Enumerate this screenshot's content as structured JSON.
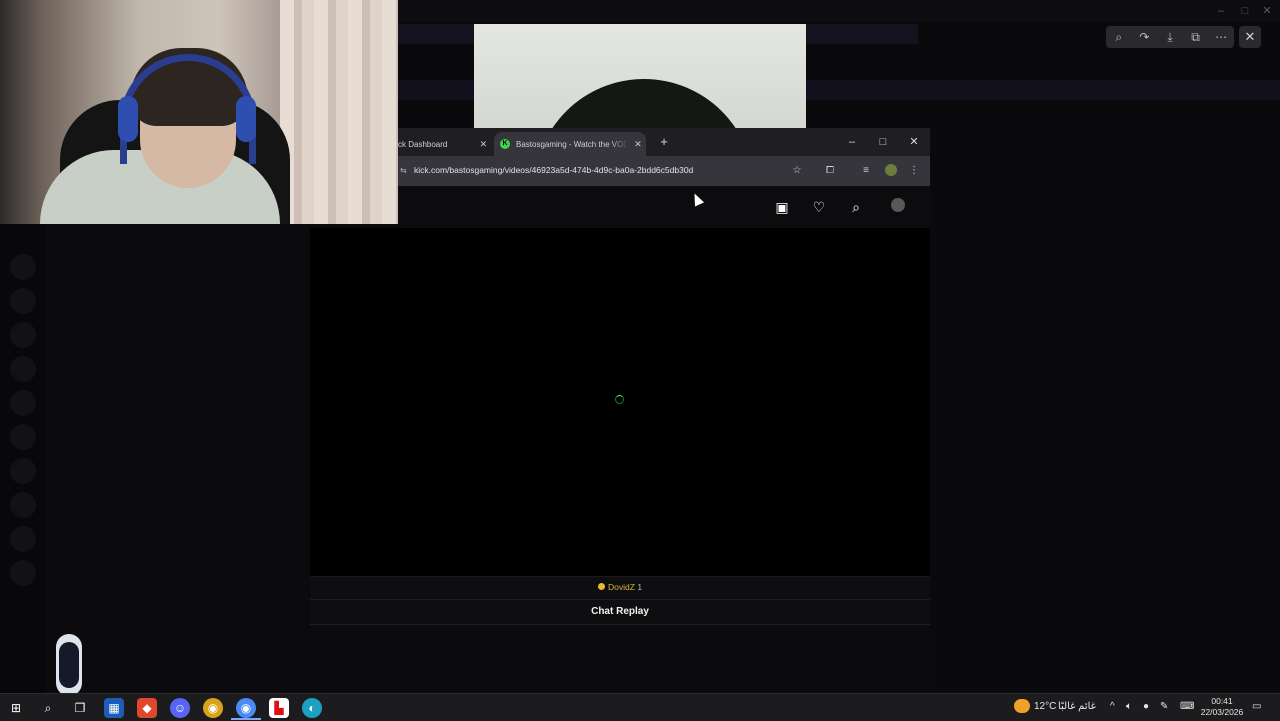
{
  "webcam": {
    "label": ""
  },
  "browser": {
    "tabs": [
      {
        "label": "Kick Dashboard",
        "visible_label": "ck Dashboard",
        "active": false
      },
      {
        "label": "Bastosgaming - Watch the VOD",
        "visible_label": "Bastosgaming - Watch the VOD",
        "active": true
      }
    ],
    "url": "kick.com/bastosgaming/videos/46923a5d-474b-4d9c-ba0a-2bdd6c5db30d",
    "new_tab_symbol": "+",
    "window_controls": {
      "minimize": "–",
      "maximize": "□",
      "close": "✕"
    }
  },
  "page": {
    "chat": {
      "user": "DovidZ",
      "user_badge_count": "1",
      "replay_label": "Chat Replay"
    },
    "accent_color": "#53fc18"
  },
  "viewer": {
    "toolbar_icons": [
      "zoom-icon",
      "share-icon",
      "download-icon",
      "open-external-icon",
      "more-icon"
    ],
    "close_symbol": "✕"
  },
  "taskbar": {
    "weather": {
      "temp": "12°C",
      "desc": "غائم غالبًا"
    },
    "clock": {
      "time": "00:41",
      "date": "22/03/2026"
    }
  },
  "colors": {
    "kick_green": "#53fc18",
    "taskbar": "#1c1c1e",
    "browser_tab_active": "#35353b"
  }
}
